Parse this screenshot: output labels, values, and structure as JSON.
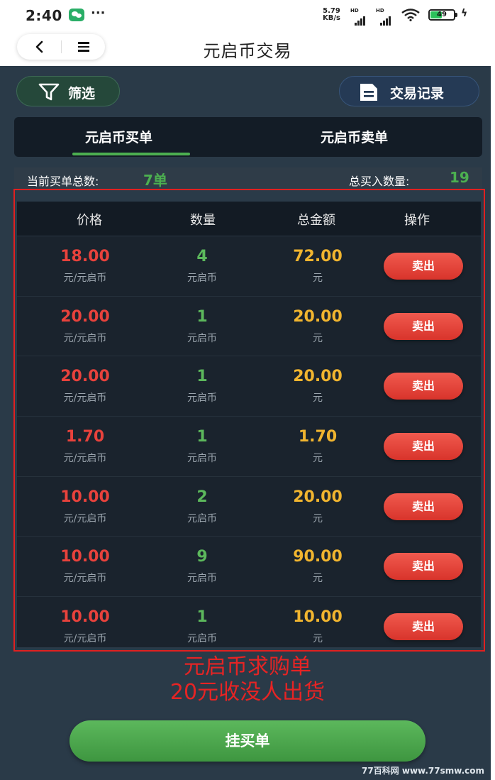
{
  "status_bar": {
    "time": "2:40",
    "dots": "···",
    "net_speed_value": "5.79",
    "net_speed_unit": "KB/s",
    "signal_label": "HD",
    "battery": "49",
    "battery_level": 0.49
  },
  "header": {
    "title": "元启币交易"
  },
  "toolbar": {
    "filter_label": "筛选",
    "record_label": "交易记录"
  },
  "tabs": [
    {
      "label": "元启币买单",
      "active": true
    },
    {
      "label": "元启币卖单",
      "active": false
    }
  ],
  "summary": {
    "total_orders_label": "当前买单总数:",
    "total_orders_value": "7单",
    "total_qty_label": "总买入数量:",
    "total_qty_value": "19"
  },
  "table": {
    "headers": [
      "价格",
      "数量",
      "总金额",
      "操作"
    ],
    "price_unit": "元/元启币",
    "qty_unit": "元启币",
    "total_unit": "元",
    "action_label": "卖出",
    "rows": [
      {
        "price": "18.00",
        "qty": "4",
        "total": "72.00"
      },
      {
        "price": "20.00",
        "qty": "1",
        "total": "20.00"
      },
      {
        "price": "20.00",
        "qty": "1",
        "total": "20.00"
      },
      {
        "price": "1.70",
        "qty": "1",
        "total": "1.70"
      },
      {
        "price": "10.00",
        "qty": "2",
        "total": "20.00"
      },
      {
        "price": "10.00",
        "qty": "9",
        "total": "90.00"
      },
      {
        "price": "10.00",
        "qty": "1",
        "total": "10.00"
      }
    ]
  },
  "annotation": {
    "line1": "元启币求购单",
    "line2": "20元收没人出货"
  },
  "bottom_button": {
    "label": "挂买单"
  },
  "watermark": "77百科网 www.77smw.com",
  "colors": {
    "price": "#e8423c",
    "qty": "#5cb85c",
    "total": "#f1b52f",
    "accent_green": "#4caf50",
    "highlight": "#e02020"
  }
}
